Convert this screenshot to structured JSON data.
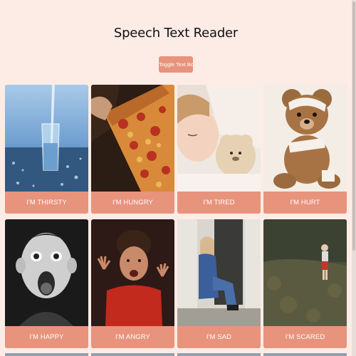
{
  "page": {
    "title": "Speech Text Reader",
    "toggle_label": "Toggle Text Box"
  },
  "cards": [
    {
      "label": "I'M THIRSTY",
      "icon": "glass-of-water-image"
    },
    {
      "label": "I'M HUNGRY",
      "icon": "pizza-image"
    },
    {
      "label": "I'M TIRED",
      "icon": "sleeping-child-image"
    },
    {
      "label": "I'M HURT",
      "icon": "bandaged-teddy-bear-image"
    },
    {
      "label": "I'M HAPPY",
      "icon": "excited-boy-image"
    },
    {
      "label": "I'M ANGRY",
      "icon": "angry-boy-image"
    },
    {
      "label": "I'M SAD",
      "icon": "sad-girl-image"
    },
    {
      "label": "I'M SCARED",
      "icon": "scared-child-in-woods-image"
    }
  ],
  "colors": {
    "background": "#fdece6",
    "accent": "#e8937c",
    "label_text": "#ffffff"
  }
}
